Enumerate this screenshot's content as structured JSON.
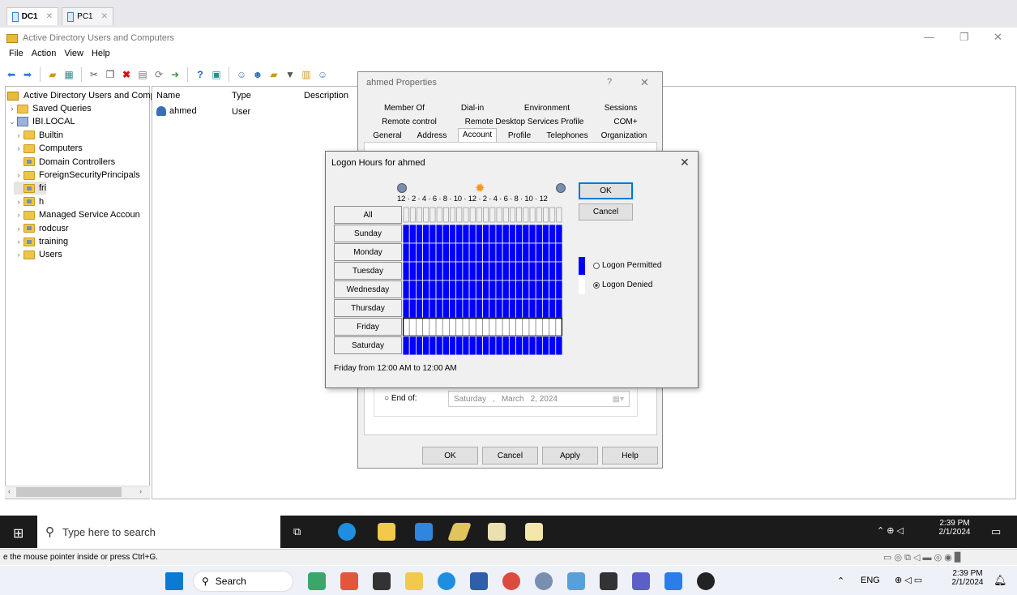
{
  "vm_tabs": [
    "DC1",
    "PC1"
  ],
  "app": {
    "title": "Active Directory Users and Computers",
    "menu": [
      "File",
      "Action",
      "View",
      "Help"
    ]
  },
  "tree": {
    "root": "Active Directory Users and Comp",
    "items": [
      {
        "label": "Saved Queries",
        "level": 1,
        "arrow": "›"
      },
      {
        "label": "IBI.LOCAL",
        "level": 1,
        "arrow": "⌄"
      },
      {
        "label": "Builtin",
        "level": 2,
        "arrow": "›"
      },
      {
        "label": "Computers",
        "level": 2,
        "arrow": "›"
      },
      {
        "label": "Domain Controllers",
        "level": 2,
        "arrow": ""
      },
      {
        "label": "ForeignSecurityPrincipals",
        "level": 2,
        "arrow": "›"
      },
      {
        "label": "fri",
        "level": 2,
        "arrow": ""
      },
      {
        "label": "h",
        "level": 2,
        "arrow": "›"
      },
      {
        "label": "Managed Service Accoun",
        "level": 2,
        "arrow": "›"
      },
      {
        "label": "rodcusr",
        "level": 2,
        "arrow": "›"
      },
      {
        "label": "training",
        "level": 2,
        "arrow": "›"
      },
      {
        "label": "Users",
        "level": 2,
        "arrow": "›"
      }
    ]
  },
  "list": {
    "columns": [
      "Name",
      "Type",
      "Description"
    ],
    "rows": [
      {
        "name": "ahmed",
        "type": "User"
      }
    ]
  },
  "props": {
    "title": "ahmed Properties",
    "help_glyph": "?",
    "tabs_row1": [
      "Member Of",
      "Dial-in",
      "Environment",
      "Sessions"
    ],
    "tabs_row2": [
      "Remote control",
      "Remote Desktop Services Profile",
      "COM+"
    ],
    "tabs_row3": [
      "General",
      "Address",
      "Account",
      "Profile",
      "Telephones",
      "Organization"
    ],
    "end_of_label": "End of:",
    "end_date": {
      "day": "Saturday",
      "month": "March",
      "date": "2, 2024"
    },
    "buttons": {
      "ok": "OK",
      "cancel": "Cancel",
      "apply": "Apply",
      "help": "Help"
    }
  },
  "logon": {
    "title": "Logon Hours for ahmed",
    "hour_scale": "12 · 2 · 4 · 6 · 8 · 10 · 12 · 2 · 4 · 6 · 8 · 10 · 12",
    "all": "All",
    "days": [
      "Sunday",
      "Monday",
      "Tuesday",
      "Wednesday",
      "Thursday",
      "Friday",
      "Saturday"
    ],
    "denied_days": [
      "Friday"
    ],
    "ok": "OK",
    "cancel": "Cancel",
    "legend_permitted": "Logon Permitted",
    "legend_denied": "Logon Denied",
    "selected_legend": "denied",
    "status": "Friday from 12:00 AM to 12:00 AM",
    "colors": {
      "permitted": "#0000ff",
      "denied": "#ffffff"
    }
  },
  "taskbar_vm": {
    "search_placeholder": "Type here to search",
    "time": "2:39 PM",
    "date": "2/1/2024"
  },
  "status_bar": "e the mouse pointer inside or press Ctrl+G.",
  "taskbar_host": {
    "search": "Search",
    "lang": "ENG",
    "time": "2:39 PM",
    "date": "2/1/2024"
  }
}
